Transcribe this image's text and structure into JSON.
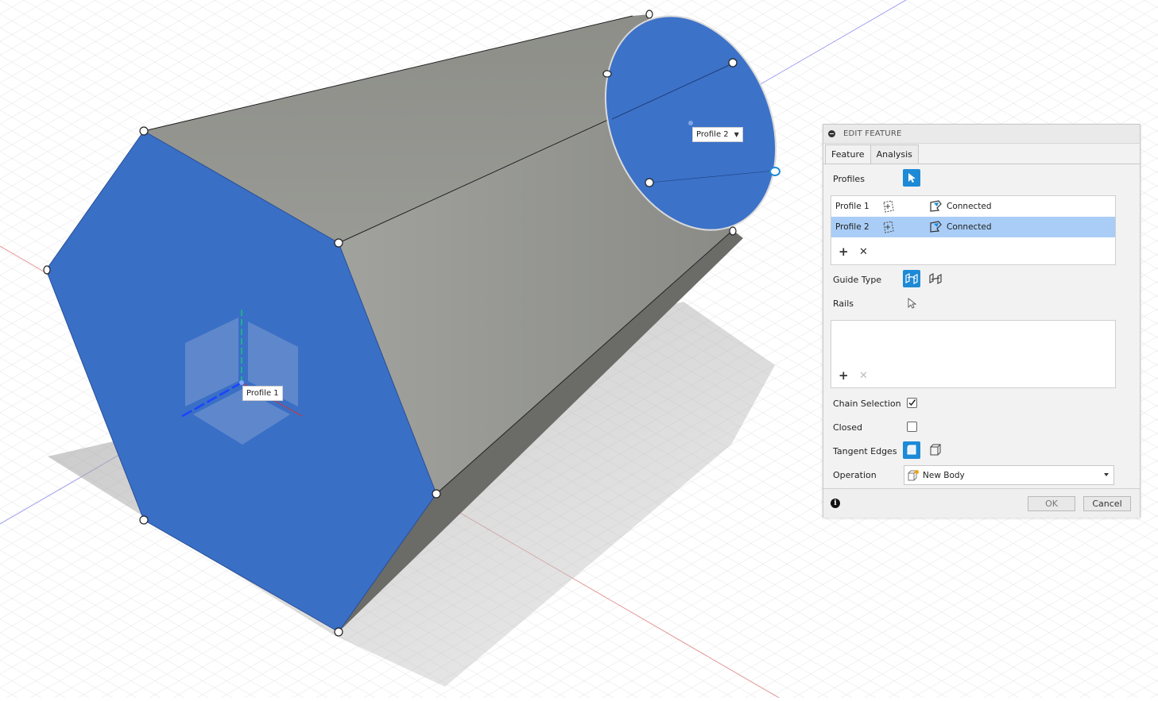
{
  "viewport": {
    "profile2_label": "Profile 2",
    "profile1_label": "Profile 1",
    "colors": {
      "profile_blue": "#3a6fc6",
      "body_gray": "#8f908b",
      "grid": "#d8d8d8"
    }
  },
  "panel": {
    "title": "EDIT FEATURE",
    "tabs": [
      {
        "label": "Feature"
      },
      {
        "label": "Analysis"
      }
    ],
    "profiles_label": "Profiles",
    "profiles": [
      {
        "name": "Profile 1",
        "status": "Connected"
      },
      {
        "name": "Profile 2",
        "status": "Connected"
      }
    ],
    "guide_type_label": "Guide Type",
    "rails_label": "Rails",
    "chain_selection_label": "Chain Selection",
    "closed_label": "Closed",
    "tangent_edges_label": "Tangent Edges",
    "operation_label": "Operation",
    "operation_value": "New Body",
    "ok_label": "OK",
    "cancel_label": "Cancel",
    "chain_selection_checked": true,
    "closed_checked": false,
    "accent_color": "#1d8ad6"
  }
}
